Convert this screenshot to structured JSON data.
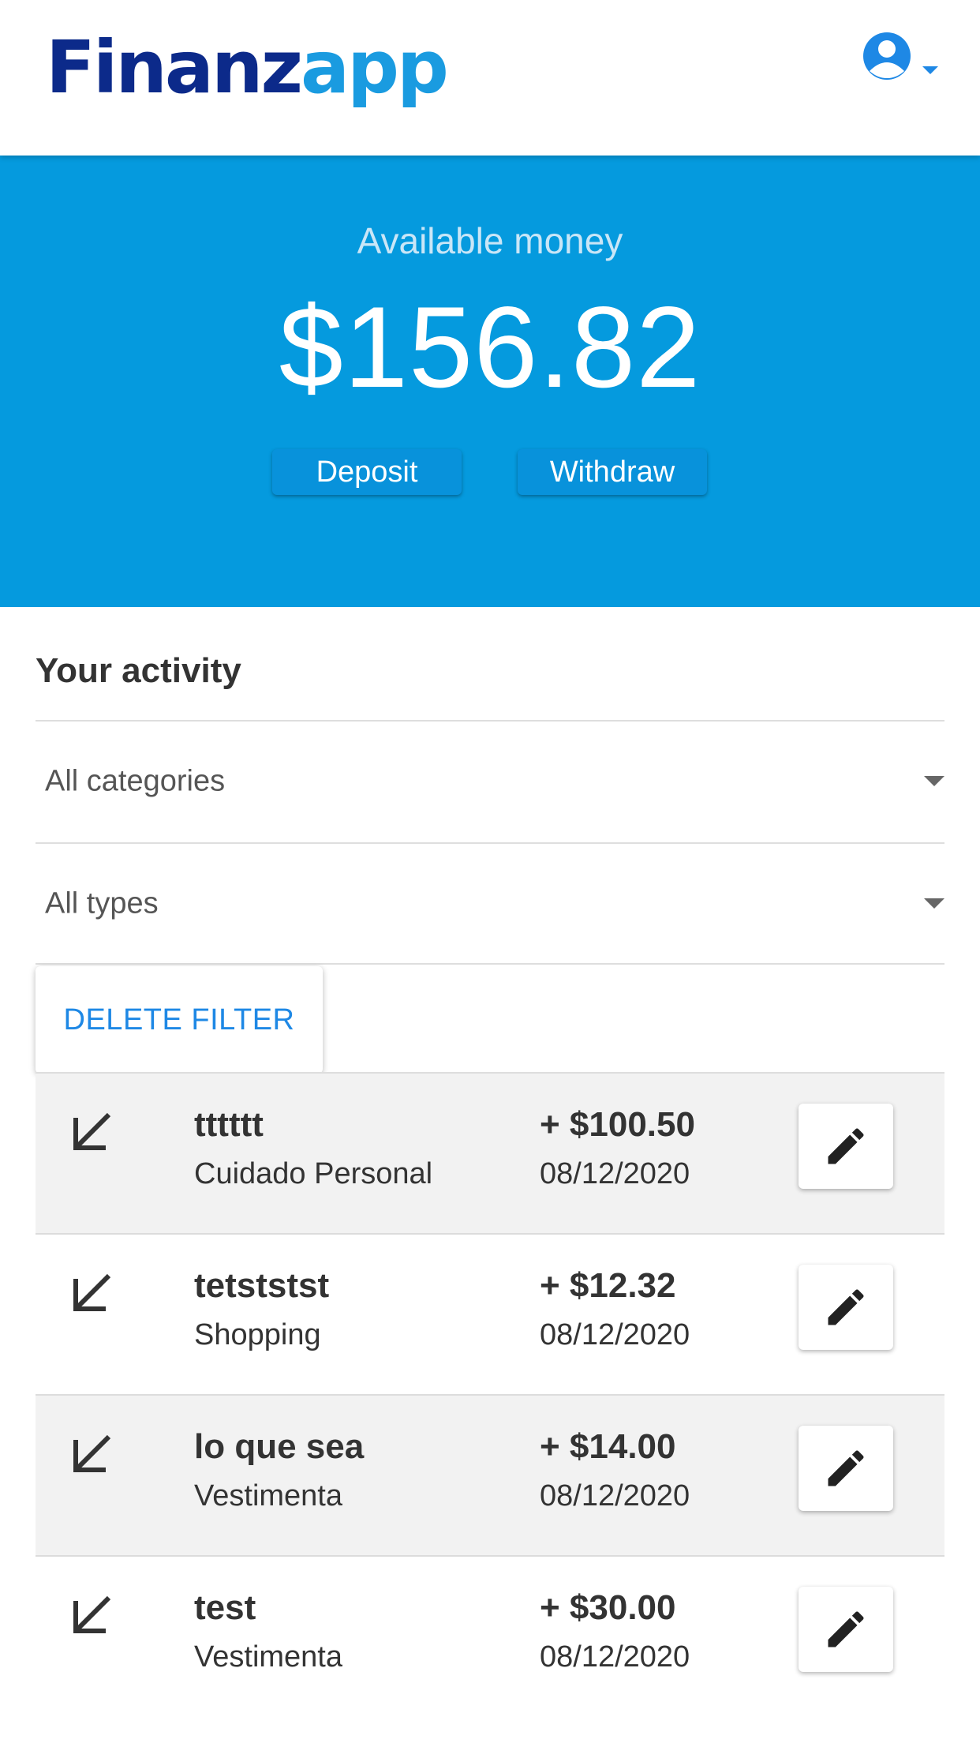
{
  "header": {
    "logo_part1": "Finanz",
    "logo_part2": "app",
    "user_icon": "account-circle-icon",
    "menu_caret_icon": "caret-down-icon"
  },
  "balance": {
    "label": "Available money",
    "amount": "$156.82",
    "deposit_label": "Deposit",
    "withdraw_label": "Withdraw",
    "background_color": "#059ade"
  },
  "activity": {
    "title": "Your activity",
    "category_filter": "All categories",
    "type_filter": "All types",
    "delete_filter_label": "DELETE FILTER",
    "transactions": [
      {
        "name": "tttttt",
        "category": "Cuidado Personal",
        "amount": "+ $100.50",
        "date": "08/12/2020",
        "icon": "arrow-down-left-icon"
      },
      {
        "name": "tetststst",
        "category": "Shopping",
        "amount": "+ $12.32",
        "date": "08/12/2020",
        "icon": "arrow-down-left-icon"
      },
      {
        "name": "lo que sea",
        "category": "Vestimenta",
        "amount": "+ $14.00",
        "date": "08/12/2020",
        "icon": "arrow-down-left-icon"
      },
      {
        "name": "test",
        "category": "Vestimenta",
        "amount": "+ $30.00",
        "date": "08/12/2020",
        "icon": "arrow-down-left-icon"
      }
    ]
  },
  "colors": {
    "brand_dark": "#0c2a8a",
    "brand_light": "#1a9be0",
    "accent_link": "#1e88e5"
  }
}
